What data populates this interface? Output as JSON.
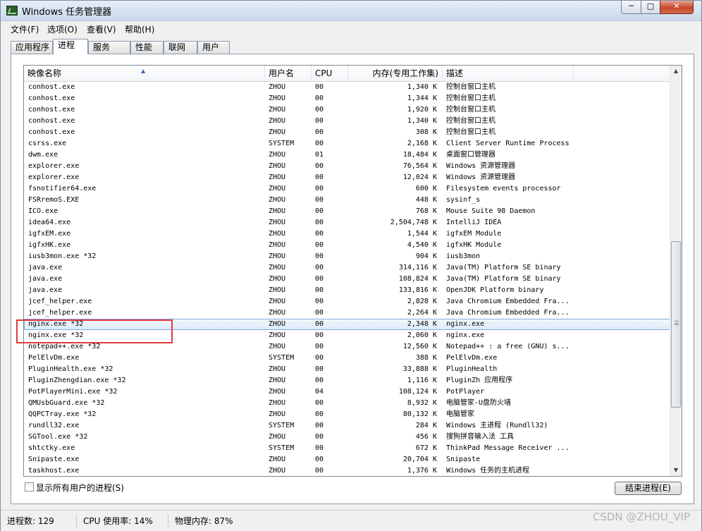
{
  "window": {
    "title": "Windows 任务管理器",
    "min_glyph": "─",
    "max_glyph": "□",
    "close_glyph": "✕"
  },
  "menu": {
    "items": [
      "文件(F)",
      "选项(O)",
      "查看(V)",
      "帮助(H)"
    ]
  },
  "tabs": {
    "items": [
      "应用程序",
      "进程",
      "服务",
      "性能",
      "联网",
      "用户"
    ],
    "active_index": 1
  },
  "table": {
    "columns": [
      "映像名称",
      "用户名",
      "CPU",
      "内存(专用工作集)",
      "描述"
    ],
    "sorted_column": "映像名称",
    "selected_row_index": 21,
    "rows": [
      {
        "name": "conhost.exe",
        "user": "ZHOU",
        "cpu": "00",
        "mem": "1,340 K",
        "desc": "控制台窗口主机"
      },
      {
        "name": "conhost.exe",
        "user": "ZHOU",
        "cpu": "00",
        "mem": "1,344 K",
        "desc": "控制台窗口主机"
      },
      {
        "name": "conhost.exe",
        "user": "ZHOU",
        "cpu": "00",
        "mem": "1,920 K",
        "desc": "控制台窗口主机"
      },
      {
        "name": "conhost.exe",
        "user": "ZHOU",
        "cpu": "00",
        "mem": "1,340 K",
        "desc": "控制台窗口主机"
      },
      {
        "name": "conhost.exe",
        "user": "ZHOU",
        "cpu": "00",
        "mem": "308 K",
        "desc": "控制台窗口主机"
      },
      {
        "name": "csrss.exe",
        "user": "SYSTEM",
        "cpu": "00",
        "mem": "2,168 K",
        "desc": "Client Server Runtime Process"
      },
      {
        "name": "dwm.exe",
        "user": "ZHOU",
        "cpu": "01",
        "mem": "18,484 K",
        "desc": "桌面窗口管理器"
      },
      {
        "name": "explorer.exe",
        "user": "ZHOU",
        "cpu": "00",
        "mem": "76,564 K",
        "desc": "Windows 资源管理器"
      },
      {
        "name": "explorer.exe",
        "user": "ZHOU",
        "cpu": "00",
        "mem": "12,024 K",
        "desc": "Windows 资源管理器"
      },
      {
        "name": "fsnotifier64.exe",
        "user": "ZHOU",
        "cpu": "00",
        "mem": "600 K",
        "desc": "Filesystem events processor"
      },
      {
        "name": "FSRremoS.EXE",
        "user": "ZHOU",
        "cpu": "00",
        "mem": "448 K",
        "desc": "sysinf_s"
      },
      {
        "name": "ICO.exe",
        "user": "ZHOU",
        "cpu": "00",
        "mem": "768 K",
        "desc": "Mouse Suite 98 Daemon"
      },
      {
        "name": "idea64.exe",
        "user": "ZHOU",
        "cpu": "00",
        "mem": "2,504,748 K",
        "desc": "IntelliJ IDEA"
      },
      {
        "name": "igfxEM.exe",
        "user": "ZHOU",
        "cpu": "00",
        "mem": "1,544 K",
        "desc": "igfxEM Module"
      },
      {
        "name": "igfxHK.exe",
        "user": "ZHOU",
        "cpu": "00",
        "mem": "4,540 K",
        "desc": "igfxHK Module"
      },
      {
        "name": "iusb3mon.exe *32",
        "user": "ZHOU",
        "cpu": "00",
        "mem": "904 K",
        "desc": "iusb3mon"
      },
      {
        "name": "java.exe",
        "user": "ZHOU",
        "cpu": "00",
        "mem": "314,116 K",
        "desc": "Java(TM) Platform SE binary"
      },
      {
        "name": "java.exe",
        "user": "ZHOU",
        "cpu": "00",
        "mem": "108,824 K",
        "desc": "Java(TM) Platform SE binary"
      },
      {
        "name": "java.exe",
        "user": "ZHOU",
        "cpu": "00",
        "mem": "133,816 K",
        "desc": "OpenJDK Platform binary"
      },
      {
        "name": "jcef_helper.exe",
        "user": "ZHOU",
        "cpu": "00",
        "mem": "2,828 K",
        "desc": "Java Chromium Embedded Fra..."
      },
      {
        "name": "jcef_helper.exe",
        "user": "ZHOU",
        "cpu": "00",
        "mem": "2,264 K",
        "desc": "Java Chromium Embedded Fra..."
      },
      {
        "name": "nginx.exe *32",
        "user": "ZHOU",
        "cpu": "00",
        "mem": "2,348 K",
        "desc": "nginx.exe"
      },
      {
        "name": "nginx.exe *32",
        "user": "ZHOU",
        "cpu": "00",
        "mem": "2,060 K",
        "desc": "nginx.exe"
      },
      {
        "name": "notepad++.exe *32",
        "user": "ZHOU",
        "cpu": "00",
        "mem": "12,560 K",
        "desc": "Notepad++ : a free (GNU) s..."
      },
      {
        "name": "PelElvDm.exe",
        "user": "SYSTEM",
        "cpu": "00",
        "mem": "388 K",
        "desc": "PelElvDm.exe"
      },
      {
        "name": "PluginHealth.exe *32",
        "user": "ZHOU",
        "cpu": "00",
        "mem": "33,888 K",
        "desc": "PluginHealth"
      },
      {
        "name": "PluginZhengdian.exe *32",
        "user": "ZHOU",
        "cpu": "00",
        "mem": "1,116 K",
        "desc": "PluginZh 应用程序"
      },
      {
        "name": "PotPlayerMini.exe *32",
        "user": "ZHOU",
        "cpu": "04",
        "mem": "108,124 K",
        "desc": "PotPlayer"
      },
      {
        "name": "QMUsbGuard.exe *32",
        "user": "ZHOU",
        "cpu": "00",
        "mem": "8,932 K",
        "desc": "电脑管家-U盘防火墙"
      },
      {
        "name": "QQPCTray.exe *32",
        "user": "ZHOU",
        "cpu": "00",
        "mem": "80,132 K",
        "desc": "电脑管家"
      },
      {
        "name": "rundll32.exe",
        "user": "SYSTEM",
        "cpu": "00",
        "mem": "284 K",
        "desc": "Windows 主进程 (Rundll32)"
      },
      {
        "name": "SGTool.exe *32",
        "user": "ZHOU",
        "cpu": "00",
        "mem": "456 K",
        "desc": "搜狗拼音输入法 工具"
      },
      {
        "name": "shtctky.exe",
        "user": "SYSTEM",
        "cpu": "00",
        "mem": "672 K",
        "desc": "ThinkPad Message Receiver ..."
      },
      {
        "name": "Snipaste.exe",
        "user": "ZHOU",
        "cpu": "00",
        "mem": "20,704 K",
        "desc": "Snipaste"
      },
      {
        "name": "taskhost.exe",
        "user": "ZHOU",
        "cpu": "00",
        "mem": "1,376 K",
        "desc": "Windows 任务的主机进程"
      }
    ]
  },
  "footer": {
    "show_all_label": "显示所有用户的进程(S)",
    "show_all_checked": false,
    "end_process_label": "结束进程(E)"
  },
  "status": {
    "process_count": "进程数: 129",
    "cpu_usage": "CPU 使用率: 14%",
    "memory": "物理内存: 87%"
  },
  "watermark": "CSDN @ZHOU_VIP",
  "colors": {
    "annotation_box": "#e03a3a",
    "selection": "#dceaf8"
  }
}
